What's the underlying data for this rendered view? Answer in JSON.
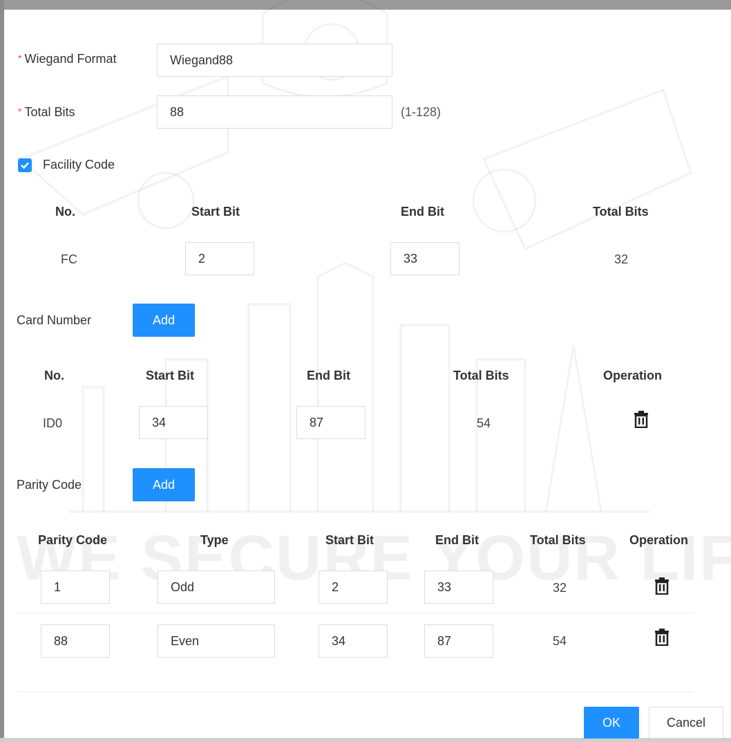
{
  "form": {
    "wiegand_format": {
      "label": "Wiegand Format",
      "value": "Wiegand88"
    },
    "total_bits": {
      "label": "Total Bits",
      "value": "88",
      "hint": "(1-128)"
    },
    "facility_code": {
      "label": "Facility Code",
      "checked": true,
      "headers": [
        "No.",
        "Start Bit",
        "End Bit",
        "Total Bits"
      ],
      "row": {
        "no": "FC",
        "start": "2",
        "end": "33",
        "total": "32"
      }
    },
    "card_number": {
      "label": "Card Number",
      "add_label": "Add",
      "headers": [
        "No.",
        "Start Bit",
        "End Bit",
        "Total Bits",
        "Operation"
      ],
      "row": {
        "no": "ID0",
        "start": "34",
        "end": "87",
        "total": "54"
      }
    },
    "parity_code": {
      "label": "Parity Code",
      "add_label": "Add",
      "headers": [
        "Parity Code",
        "Type",
        "Start Bit",
        "End Bit",
        "Total Bits",
        "Operation"
      ],
      "rows": [
        {
          "code": "1",
          "type": "Odd",
          "start": "2",
          "end": "33",
          "total": "32"
        },
        {
          "code": "88",
          "type": "Even",
          "start": "34",
          "end": "87",
          "total": "54"
        }
      ]
    }
  },
  "footer": {
    "ok_label": "OK",
    "cancel_label": "Cancel"
  },
  "watermark": {
    "text": "WE SECURE YOUR LIFE"
  },
  "colors": {
    "primary": "#1e90ff",
    "required": "#e04b4b"
  },
  "icons": {
    "delete": "trash-icon",
    "check": "check-icon"
  }
}
